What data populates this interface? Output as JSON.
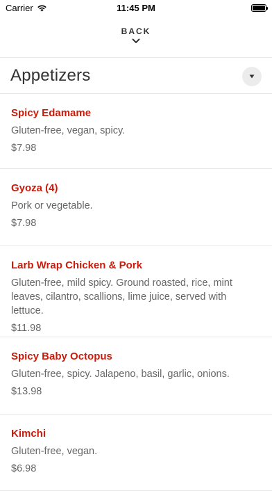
{
  "status_bar": {
    "carrier": "Carrier",
    "time": "11:45 PM"
  },
  "nav": {
    "back_label": "BACK"
  },
  "section": {
    "title": "Appetizers"
  },
  "items": [
    {
      "name": "Spicy Edamame",
      "description": "Gluten-free, vegan, spicy.",
      "price": "$7.98"
    },
    {
      "name": "Gyoza (4)",
      "description": "Pork or vegetable.",
      "price": "$7.98"
    },
    {
      "name": "Larb Wrap Chicken & Pork",
      "description": "Gluten-free, mild spicy. Ground roasted, rice, mint leaves, cilantro, scallions, lime juice, served with lettuce.",
      "price": "$11.98"
    },
    {
      "name": "Spicy Baby Octopus",
      "description": "Gluten-free, spicy. Jalapeno, basil, garlic, onions.",
      "price": "$13.98"
    },
    {
      "name": "Kimchi",
      "description": "Gluten-free, vegan.",
      "price": "$6.98"
    }
  ],
  "colors": {
    "accent": "#cc1b0a",
    "text_secondary": "#666666"
  }
}
